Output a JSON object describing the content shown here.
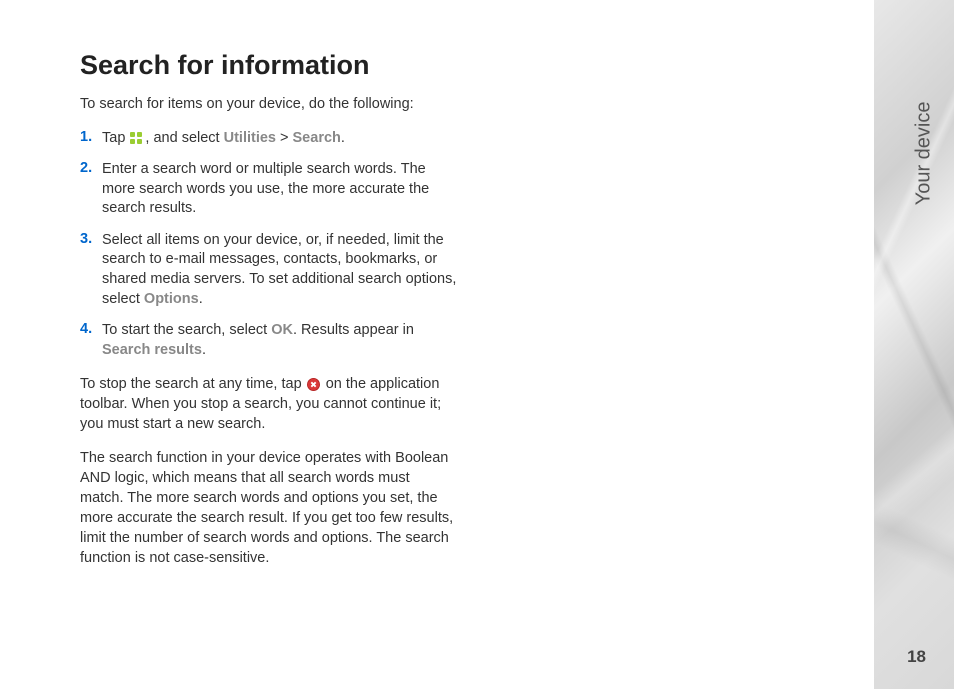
{
  "heading": "Search for information",
  "intro": "To search for items on your device, do the following:",
  "steps": [
    {
      "num": "1.",
      "pre": "Tap ",
      "mid": ", and select ",
      "bold1": "Utilities",
      "sep": " > ",
      "bold2": "Search",
      "post": "."
    },
    {
      "num": "2.",
      "text": "Enter a search word or multiple search words. The more search words you use, the more accurate the search results."
    },
    {
      "num": "3.",
      "pre": "Select all items on your device, or, if needed, limit the search to e-mail messages, contacts, bookmarks, or shared media servers. To set additional search options, select ",
      "bold1": "Options",
      "post": "."
    },
    {
      "num": "4.",
      "pre": "To start the search, select ",
      "bold1": "OK",
      "mid": ". Results appear in ",
      "bold2": "Search results",
      "post": "."
    }
  ],
  "para1_pre": "To stop the search at any time, tap ",
  "para1_post": " on the application toolbar. When you stop a search, you cannot continue it; you must start a new search.",
  "para2": "The search function in your device operates with Boolean AND logic, which means that all search words must match. The more search words and options you set, the more accurate the search result. If you get too few results, limit the number of search words and options. The search function is not case-sensitive.",
  "sideLabel": "Your device",
  "pageNum": "18"
}
